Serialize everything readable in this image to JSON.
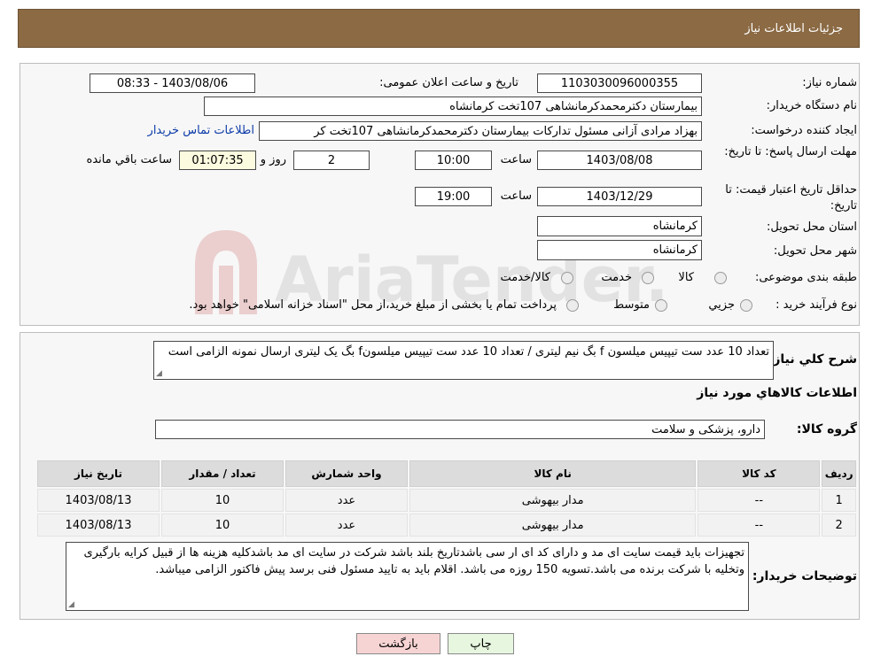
{
  "header": {
    "title": "جزئیات اطلاعات نیاز"
  },
  "watermark": {
    "text": "AriaTender.neT"
  },
  "form": {
    "need_number": {
      "label": "شماره نیاز:",
      "value": "1103030096000355"
    },
    "announce": {
      "label": "تاریخ و ساعت اعلان عمومی:",
      "value": "1403/08/06 - 08:33"
    },
    "buyer_org": {
      "label": "نام دستگاه خریدار:",
      "value": "بیمارستان دکترمحمدکرمانشاهی 107تخت کرمانشاه"
    },
    "requester": {
      "label": "ایجاد کننده درخواست:",
      "value": "بهزاد مرادی آزانی مسئول تداركات بیمارستان دکترمحمدکرمانشاهی 107تخت کر",
      "contact_link": "اطلاعات تماس خریدار"
    },
    "response_deadline": {
      "label": "مهلت ارسال پاسخ: تا تاریخ:",
      "date": "1403/08/08",
      "time_label": "ساعت",
      "time": "10:00",
      "days": "2",
      "days_label": "روز و",
      "remaining": "01:07:35",
      "remaining_label": "ساعت باقي مانده"
    },
    "price_validity": {
      "label": "حداقل تاریخ اعتبار قیمت: تا تاریخ:",
      "date": "1403/12/29",
      "time_label": "ساعت",
      "time": "19:00"
    },
    "delivery_province": {
      "label": "استان محل تحویل:",
      "value": "کرمانشاه"
    },
    "delivery_city": {
      "label": "شهر محل تحویل:",
      "value": "کرمانشاه"
    },
    "category": {
      "label": "طبقه بندی موضوعی:",
      "options": [
        "کالا",
        "خدمت",
        "کالا/خدمت"
      ]
    },
    "process": {
      "label": "نوع فرآیند خرید :",
      "options": [
        "جزیي",
        "متوسط"
      ],
      "note": "پرداخت تمام یا بخشی از مبلغ خرید،از محل \"اسناد خزانه اسلامی\" خواهد بود."
    }
  },
  "description": {
    "label": "شرح كلي نياز:",
    "text": "تعداد 10 عدد ست تیپیس میلسون f بگ نیم لیتری / تعداد 10 عدد ست تیپیس میلسونf بگ یک لیتری ارسال نمونه الزامی است"
  },
  "goods_section": {
    "title": "اطلاعات کالاهاي مورد نياز"
  },
  "goods_group": {
    "label": "گروه کالا:",
    "value": "دارو، پزشکی و سلامت"
  },
  "table": {
    "headers": [
      "رديف",
      "کد کالا",
      "نام کالا",
      "واحد شمارش",
      "تعداد / مقدار",
      "تاریخ نیاز"
    ],
    "rows": [
      [
        "1",
        "--",
        "مدار بیهوشی",
        "عدد",
        "10",
        "1403/08/13"
      ],
      [
        "2",
        "--",
        "مدار بیهوشی",
        "عدد",
        "10",
        "1403/08/13"
      ]
    ]
  },
  "buyer_notes": {
    "label": "توضیحات خریدار:",
    "text": "تجهیزات باید قیمت سایت ای مد و دارای کد ای ار سی باشدتاریخ بلند باشد شرکت در سایت ای مد باشدکلیه هزینه ها از قبیل کرایه بارگیری وتخلیه با شرکت برنده می باشد.تسویه 150 روزه می باشد. اقلام باید به تایید مسئول فنی برسد پیش فاکتور الزامی میباشد."
  },
  "buttons": {
    "print": "چاپ",
    "back": "بازگشت"
  },
  "colors": {
    "header_bg": "#8b6a44",
    "back_btn_bg": "#f7d4d4",
    "print_btn_bg": "#e7f6df",
    "link": "#0b3aa8",
    "remaining_bg": "#fbfbe0"
  }
}
